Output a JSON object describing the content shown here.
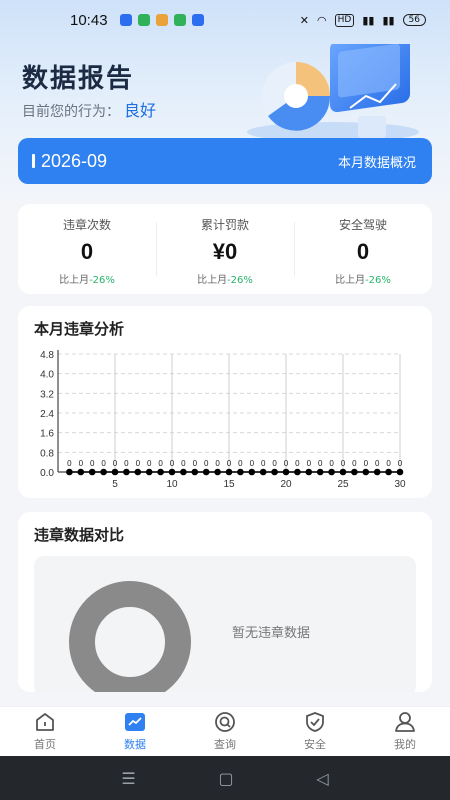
{
  "status": {
    "time": "10:43",
    "hd": "HD",
    "battery": "56"
  },
  "header": {
    "title": "数据报告",
    "behavior_label": "目前您的行为：",
    "behavior_value": "良好"
  },
  "month_bar": {
    "month": "2026-09",
    "overview_label": "本月数据概况"
  },
  "stats": [
    {
      "label": "违章次数",
      "value": "0",
      "compare_label": "比上月",
      "compare_pct": "-26%"
    },
    {
      "label": "累计罚款",
      "value": "¥0",
      "compare_label": "比上月",
      "compare_pct": "-26%"
    },
    {
      "label": "安全驾驶",
      "value": "0",
      "compare_label": "比上月",
      "compare_pct": "-26%"
    }
  ],
  "violation_chart": {
    "title": "本月违章分析",
    "chart_data": {
      "type": "line",
      "x": [
        1,
        2,
        3,
        4,
        5,
        6,
        7,
        8,
        9,
        10,
        11,
        12,
        13,
        14,
        15,
        16,
        17,
        18,
        19,
        20,
        21,
        22,
        23,
        24,
        25,
        26,
        27,
        28,
        29,
        30
      ],
      "values": [
        0,
        0,
        0,
        0,
        0,
        0,
        0,
        0,
        0,
        0,
        0,
        0,
        0,
        0,
        0,
        0,
        0,
        0,
        0,
        0,
        0,
        0,
        0,
        0,
        0,
        0,
        0,
        0,
        0,
        0
      ],
      "data_labels": [
        "0",
        "0",
        "0",
        "0",
        "0",
        "0",
        "0",
        "0",
        "0",
        "0",
        "0",
        "0",
        "0",
        "0",
        "0",
        "0",
        "0",
        "0",
        "0",
        "0",
        "0",
        "0",
        "0",
        "0",
        "0",
        "0",
        "0",
        "0",
        "0",
        "0"
      ],
      "x_ticks": [
        "5",
        "10",
        "15",
        "20",
        "25",
        "30"
      ],
      "y_ticks": [
        "0.0",
        "0.8",
        "1.6",
        "2.4",
        "3.2",
        "4.0",
        "4.8"
      ],
      "ylim": [
        0,
        4.8
      ],
      "xlim": [
        0,
        30
      ],
      "grid": true
    }
  },
  "compare_section": {
    "title": "违章数据对比",
    "empty_text": "暂无违章数据"
  },
  "bottom_nav": [
    {
      "label": "首页",
      "icon": "home-icon",
      "active": false
    },
    {
      "label": "数据",
      "icon": "chart-icon",
      "active": true
    },
    {
      "label": "查询",
      "icon": "search-icon",
      "active": false
    },
    {
      "label": "安全",
      "icon": "shield-check-icon",
      "active": false
    },
    {
      "label": "我的",
      "icon": "user-icon",
      "active": false
    }
  ],
  "colors": {
    "accent": "#2f80f0",
    "positive": "#27b36a",
    "donut": "#8a8a8a"
  }
}
